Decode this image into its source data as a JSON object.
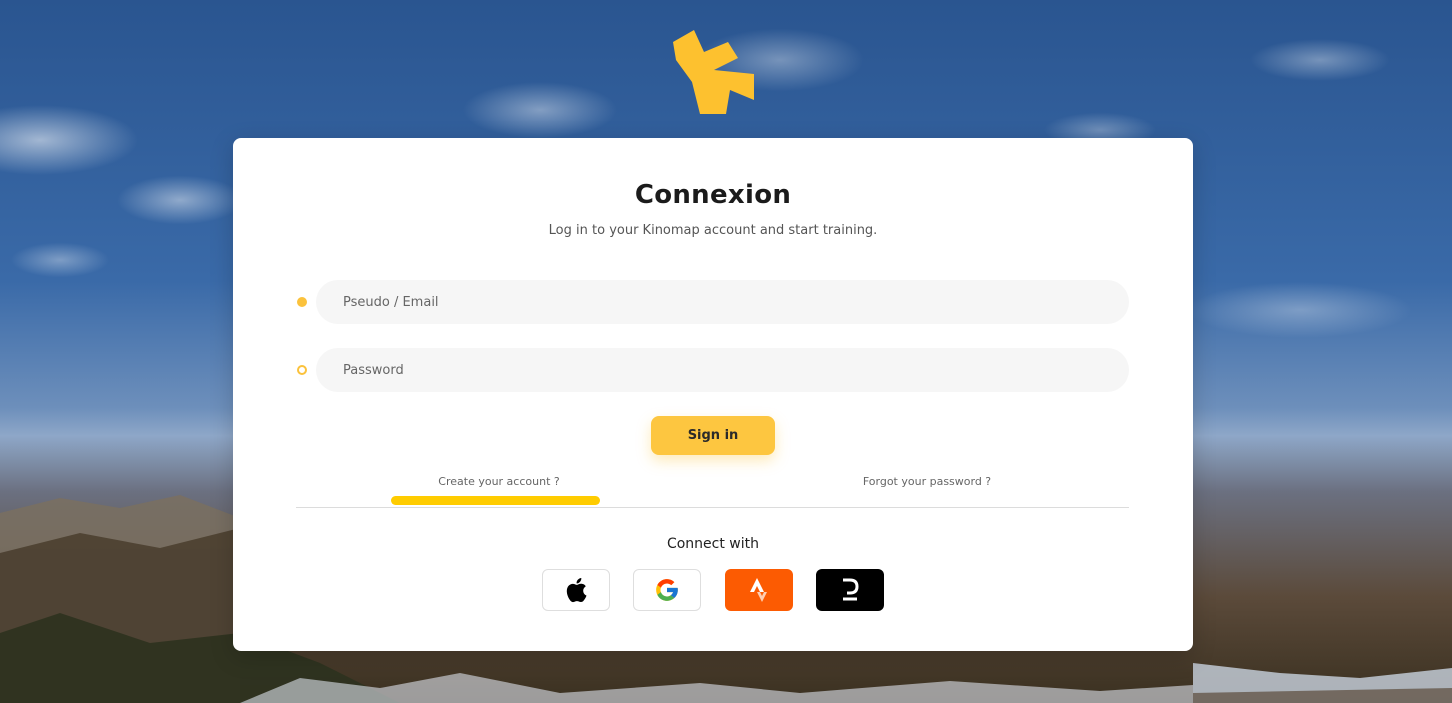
{
  "brand": {
    "logo_icon": "kinomap-logo-icon",
    "accent_color": "#fdc640"
  },
  "login": {
    "title": "Connexion",
    "subtitle": "Log in to your Kinomap account and start training.",
    "email_placeholder": "Pseudo / Email",
    "password_placeholder": "Password",
    "signin_label": "Sign in"
  },
  "links": {
    "create_account": "Create your account ?",
    "forgot_password": "Forgot your password ?"
  },
  "social": {
    "label": "Connect with",
    "providers": [
      {
        "icon": "apple-icon",
        "color": "#000000"
      },
      {
        "icon": "google-icon",
        "color": "#4285f4"
      },
      {
        "icon": "strava-icon",
        "color": "#fc5b02"
      },
      {
        "icon": "d-brand-icon",
        "color": "#000000"
      }
    ]
  }
}
